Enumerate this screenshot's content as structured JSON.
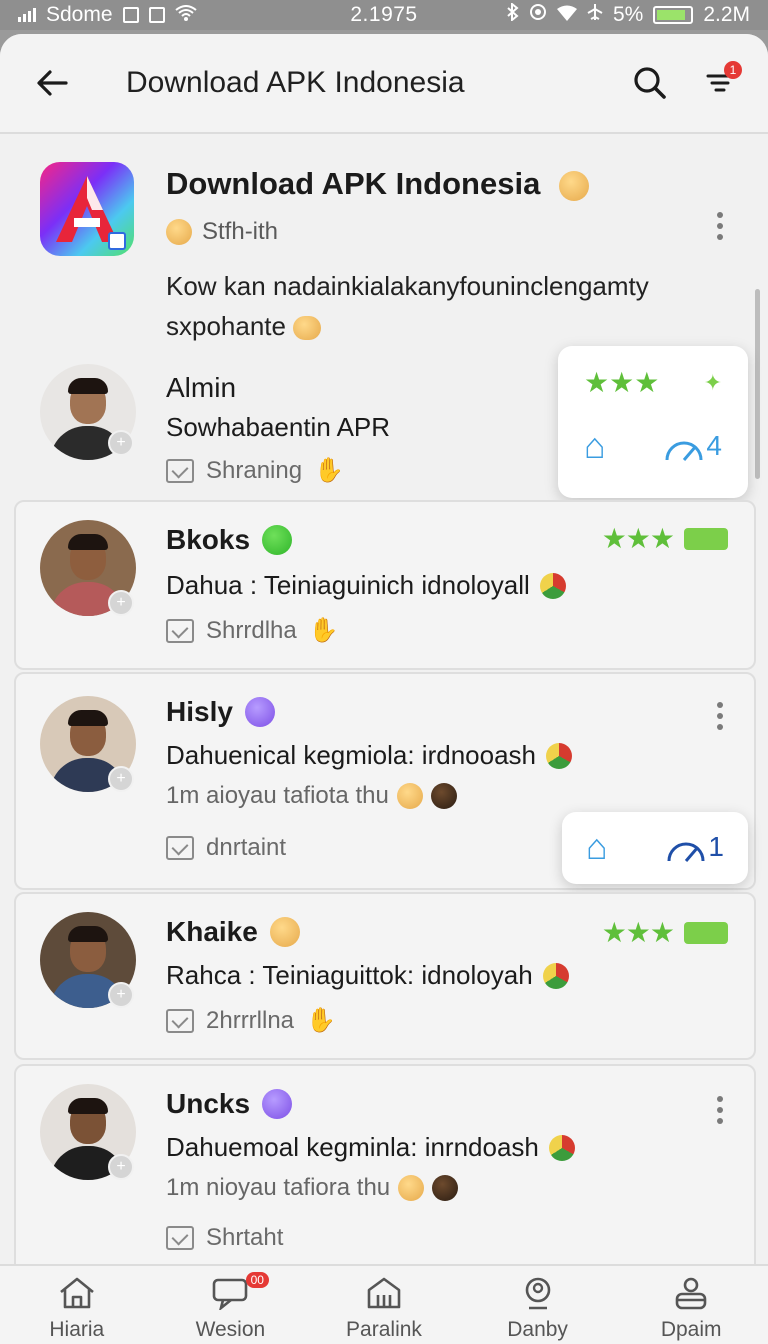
{
  "status_bar": {
    "carrier": "Sdome",
    "time": "2.1975",
    "battery_percent": "5%",
    "right_label": "2.2M"
  },
  "app_bar": {
    "title": "Download APK Indonesia",
    "notification_count": "1"
  },
  "app_header": {
    "name": "Download APK Indonesia",
    "subtitle": "Stfh-ith",
    "description": "Kow kan nadainkialakanyfouninclengamty sxpohante"
  },
  "reviews": [
    {
      "name": "Almin",
      "text": "Sowhabaentin APR",
      "action": "Shraning",
      "bold": false
    },
    {
      "name": "Bkoks",
      "text": "Dahua : Teiniaguinich idnoloyall",
      "action": "Shrrdlha",
      "bold": true
    },
    {
      "name": "Hisly",
      "text": "Dahuenical kegmiola: irdnooash",
      "meta": "1m aioyau tafiota thu",
      "action": "dnrtaint",
      "bold": true
    },
    {
      "name": "Khaike",
      "text": "Rahca : Teiniaguittok: idnoloyah",
      "action": "2hrrrllna",
      "bold": true
    },
    {
      "name": "Uncks",
      "text": "Dahuemoal kegminla: inrndoash",
      "meta": "1m nioyau tafiora thu",
      "action": "Shrtaht",
      "bold": true
    }
  ],
  "popups": {
    "first_count": "4",
    "second_count": "1"
  },
  "bottom_nav": [
    {
      "label": "Hiaria",
      "icon": "home-icon"
    },
    {
      "label": "Wesion",
      "icon": "chat-icon",
      "badge": "00"
    },
    {
      "label": "Paralink",
      "icon": "building-icon"
    },
    {
      "label": "Danby",
      "icon": "search-person-icon"
    },
    {
      "label": "Dpaim",
      "icon": "profile-icon"
    }
  ],
  "colors": {
    "accent_blue": "#3a9ce0",
    "star_green": "#5fbf3a",
    "badge_red": "#e53935"
  }
}
